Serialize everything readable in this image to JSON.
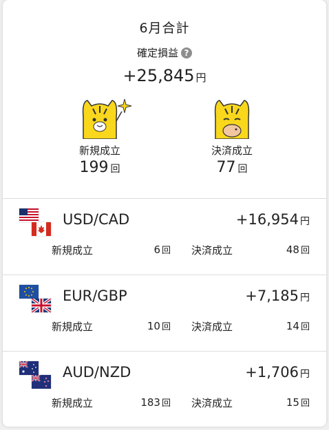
{
  "summary": {
    "title": "6月合計",
    "pl_label": "確定損益",
    "help_icon": "question-icon",
    "total_value": "+25,845",
    "currency_unit": "円",
    "new_label": "新規成立",
    "new_count": "199",
    "settle_label": "決済成立",
    "settle_count": "77",
    "count_unit": "回"
  },
  "pairs": [
    {
      "name": "USD/CAD",
      "profit": "+16,954",
      "unit": "円",
      "new_label": "新規成立",
      "new_count": "6",
      "settle_label": "決済成立",
      "settle_count": "48",
      "count_unit": "回",
      "flags": [
        "us-flag-icon",
        "canada-flag-icon"
      ]
    },
    {
      "name": "EUR/GBP",
      "profit": "+7,185",
      "unit": "円",
      "new_label": "新規成立",
      "new_count": "10",
      "settle_label": "決済成立",
      "settle_count": "14",
      "count_unit": "回",
      "flags": [
        "eu-flag-icon",
        "uk-flag-icon"
      ]
    },
    {
      "name": "AUD/NZD",
      "profit": "+1,706",
      "unit": "円",
      "new_label": "新規成立",
      "new_count": "183",
      "settle_label": "決済成立",
      "settle_count": "15",
      "count_unit": "回",
      "flags": [
        "australia-flag-icon",
        "new-zealand-flag-icon"
      ]
    }
  ],
  "colors": {
    "tiger_yellow": "#f9d71c",
    "divider": "#dcdcdc",
    "text": "#222222"
  }
}
